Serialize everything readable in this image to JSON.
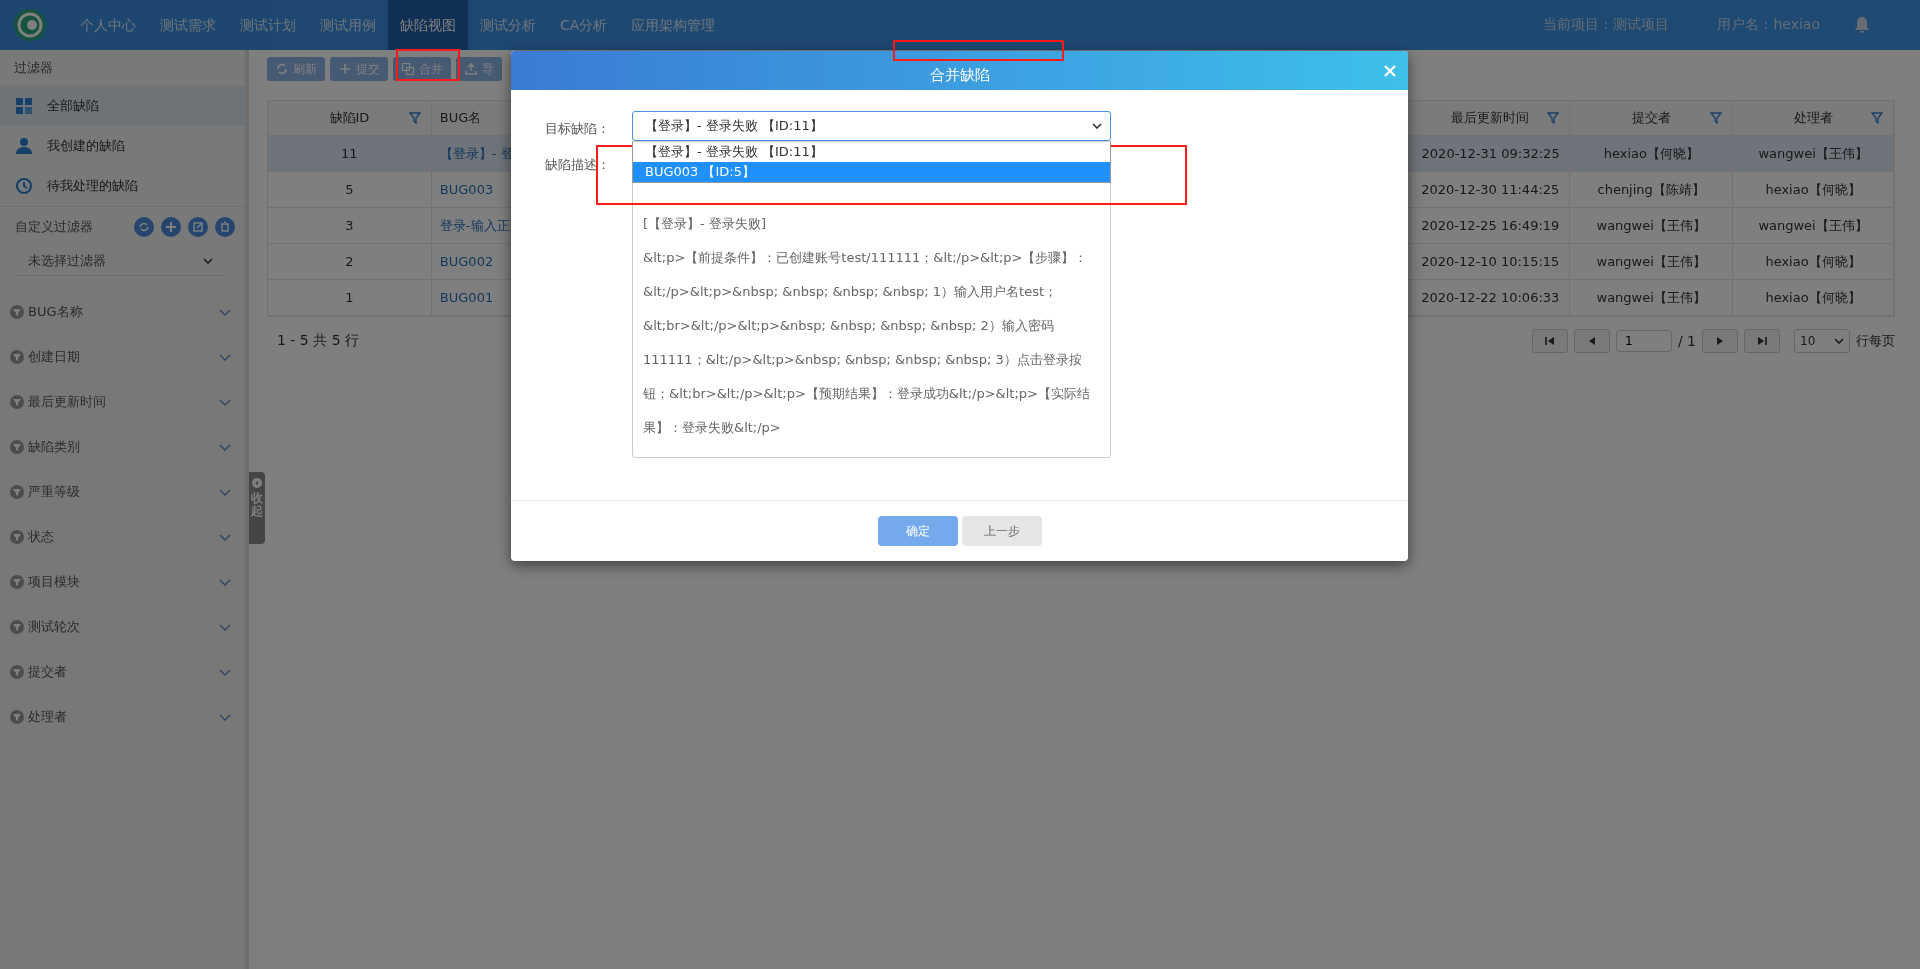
{
  "nav": {
    "items": [
      {
        "label": "个人中心",
        "selected": false
      },
      {
        "label": "测试需求",
        "selected": false
      },
      {
        "label": "测试计划",
        "selected": false
      },
      {
        "label": "测试用例",
        "selected": false
      },
      {
        "label": "缺陷视图",
        "selected": true
      },
      {
        "label": "测试分析",
        "selected": false
      },
      {
        "label": "CA分析",
        "selected": false
      },
      {
        "label": "应用架构管理",
        "selected": false
      }
    ],
    "project": "当前项目：测试项目",
    "user": "用户名：hexiao"
  },
  "sidebar": {
    "title": "过滤器",
    "items": [
      {
        "label": "全部缺陷",
        "kind": "grid",
        "selected": true
      },
      {
        "label": "我创建的缺陷",
        "kind": "user",
        "selected": false
      },
      {
        "label": "待我处理的缺陷",
        "kind": "clock",
        "selected": false
      }
    ],
    "custom_filter": {
      "label": "自定义过滤器",
      "select": "未选择过滤器"
    },
    "filter_groups": [
      "BUG名称",
      "创建日期",
      "最后更新时间",
      "缺陷类别",
      "严重等级",
      "状态",
      "项目模块",
      "测试轮次",
      "提交者",
      "处理者"
    ],
    "collapse": "收起"
  },
  "toolbar": [
    {
      "label": "刷新",
      "kind": "refresh"
    },
    {
      "label": "提交",
      "kind": "plus"
    },
    {
      "label": "合并",
      "kind": "merge"
    },
    {
      "label": "导",
      "kind": "upload"
    }
  ],
  "table": {
    "columns_left": [
      "缺陷ID",
      "BUG名"
    ],
    "columns_right": [
      "最后更新时间",
      "提交者",
      "处理者"
    ],
    "rows": [
      {
        "id": "11",
        "name": "【登录】- 登",
        "updated": "2020-12-31 09:32:25",
        "submitter": "hexiao【何晓】",
        "handler": "wangwei【王伟】",
        "selected": true
      },
      {
        "id": "5",
        "name": "BUG003",
        "updated": "2020-12-30 11:44:25",
        "submitter": "chenjing【陈靖】",
        "handler": "hexiao【何晓】",
        "selected": false
      },
      {
        "id": "3",
        "name": "登录-输入正",
        "updated": "2020-12-25 16:49:19",
        "submitter": "wangwei【王伟】",
        "handler": "wangwei【王伟】",
        "selected": false
      },
      {
        "id": "2",
        "name": "BUG002",
        "updated": "2020-12-10 10:15:15",
        "submitter": "wangwei【王伟】",
        "handler": "hexiao【何晓】",
        "selected": false
      },
      {
        "id": "1",
        "name": "BUG001",
        "updated": "2020-12-22 10:06:33",
        "submitter": "wangwei【王伟】",
        "handler": "hexiao【何晓】",
        "selected": false
      }
    ]
  },
  "pagination": {
    "summary": "1 - 5 共 5 行",
    "page": "1",
    "total": "/ 1",
    "page_size": "10",
    "per_page": "行每页"
  },
  "dialog": {
    "title": "合并缺陷",
    "target_label": "目标缺陷：",
    "target_value": "【登录】- 登录失败 【ID:11】",
    "options": [
      {
        "label": "【登录】- 登录失败 【ID:11】",
        "selected": false
      },
      {
        "label": "BUG003 【ID:5】",
        "selected": true
      }
    ],
    "description_label": "缺陷描述：",
    "description": "[【登录】- 登录失败]\n&lt;p>【前提条件】：已创建账号test/111111；&lt;/p>&lt;p>【步骤】：&lt;/p>&lt;p>&nbsp; &nbsp; &nbsp; &nbsp; 1）输入用户名test；&lt;br>&lt;/p>&lt;p>&nbsp; &nbsp; &nbsp; &nbsp; 2）输入密码111111；&lt;/p>&lt;p>&nbsp; &nbsp; &nbsp; &nbsp; 3）点击登录按钮；&lt;br>&lt;/p>&lt;p>【预期结果】：登录成功&lt;/p>&lt;p>【实际结果】：登录失败&lt;/p>",
    "buttons": [
      {
        "label": "确定",
        "kind": "primary"
      },
      {
        "label": "上一步",
        "kind": "secondary"
      }
    ]
  }
}
